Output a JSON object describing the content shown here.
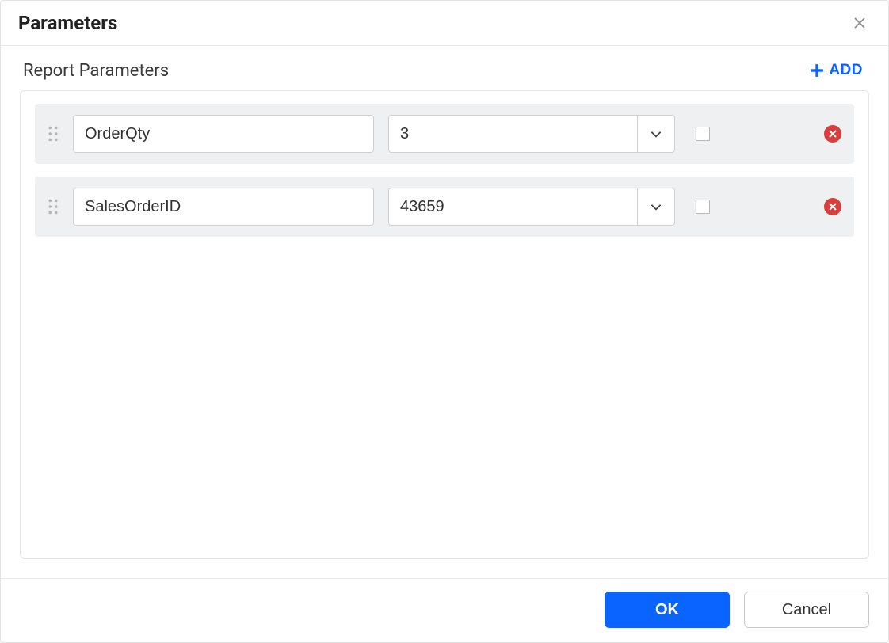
{
  "dialog": {
    "title": "Parameters"
  },
  "section": {
    "title": "Report Parameters",
    "add_label": "ADD"
  },
  "parameters": [
    {
      "name": "OrderQty",
      "value": "3",
      "checked": false
    },
    {
      "name": "SalesOrderID",
      "value": "43659",
      "checked": false
    }
  ],
  "footer": {
    "ok_label": "OK",
    "cancel_label": "Cancel"
  },
  "colors": {
    "accent": "#0a64ff",
    "danger": "#db3c3c"
  }
}
